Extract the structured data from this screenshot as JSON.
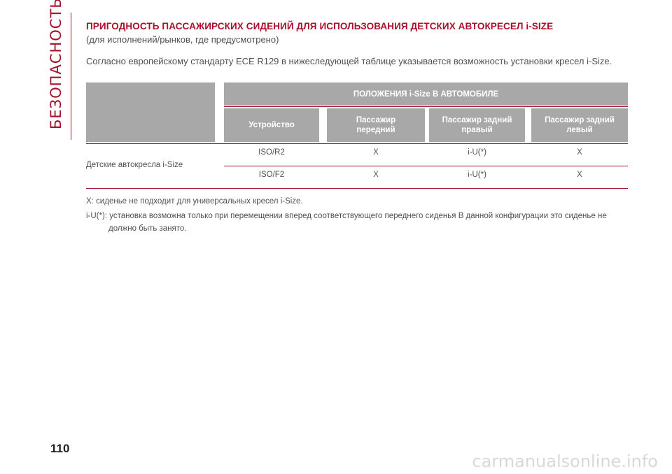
{
  "side_label": "БЕЗОПАСНОСТЬ",
  "title": "ПРИГОДНОСТЬ ПАССАЖИРСКИХ СИДЕНИЙ ДЛЯ ИСПОЛЬЗОВАНИЯ ДЕТСКИХ АВТОКРЕСЕЛ i-SIZE",
  "subtitle": "(для исполнений/рынков, где предусмотрено)",
  "intro": "Согласно европейскому стандарту ECE R129 в нижеследующей таблице указывается возможность установки кресел i-Size.",
  "table": {
    "header_main": "ПОЛОЖЕНИЯ i-Size В АВТОМОБИЛЕ",
    "columns": [
      "Устройство",
      "Пассажир передний",
      "Пассажир задний правый",
      "Пассажир задний левый"
    ],
    "row_label": "Детские автокресла i-Size",
    "rows": [
      {
        "device": "ISO/R2",
        "front": "X",
        "rear_right": "i-U(*)",
        "rear_left": "X"
      },
      {
        "device": "ISO/F2",
        "front": "X",
        "rear_right": "i-U(*)",
        "rear_left": "X"
      }
    ]
  },
  "notes": {
    "note1": "X: сиденье не подходит для универсальных кресел i-Size.",
    "note2": "i-U(*): установка возможна только при перемещении вперед соответствующего переднего сиденья В данной конфигурации это сиденье не",
    "note2_cont": "должно быть занято."
  },
  "page_number": "110",
  "watermark": "carmanualsonline.info",
  "colors": {
    "accent": "#a8112c",
    "header_gray": "#a8a8a8",
    "text": "#505050"
  }
}
